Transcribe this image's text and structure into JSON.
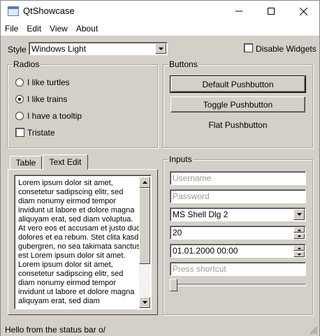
{
  "window": {
    "title": "QtShowcase"
  },
  "menu": {
    "items": [
      "File",
      "Edit",
      "View",
      "About"
    ]
  },
  "style": {
    "label": "Style",
    "value": "Windows Light"
  },
  "disable_widgets": {
    "label": "Disable Widgets",
    "checked": false
  },
  "radios": {
    "title": "Radios",
    "items": [
      {
        "label": "I like turtles",
        "checked": false
      },
      {
        "label": "I like trains",
        "checked": true
      },
      {
        "label": "I have a tooltip",
        "checked": false
      }
    ],
    "tristate": {
      "label": "Tristate",
      "checked": false
    }
  },
  "buttons": {
    "title": "Buttons",
    "default_label": "Default Pushbutton",
    "toggle_label": "Toggle Pushbutton",
    "flat_label": "Flat Pushbutton"
  },
  "tabs": {
    "items": [
      "Table",
      "Text Edit"
    ],
    "active": "Text Edit",
    "text": "Lorem ipsum dolor sit amet, consetetur sadipscing elitr, sed diam nonumy eirmod tempor invidunt ut labore et dolore magna aliquyam erat, sed diam voluptua. At vero eos et accusam et justo duo dolores et ea rebum. Stet clita kasd gubergren, no sea takimata sanctus est Lorem ipsum dolor sit amet. Lorem ipsum dolor sit amet, consetetur sadipscing elitr, sed diam nonumy eirmod tempor invidunt ut labore et dolore magna aliquyam erat, sed diam"
  },
  "inputs": {
    "title": "Inputs",
    "username_placeholder": "Username",
    "password_placeholder": "Password",
    "font_value": "MS Shell Dlg 2",
    "spin_value": "20",
    "datetime_value": "01.01.2000 00:00",
    "shortcut_placeholder": "Press shortcut",
    "slider_value": 0
  },
  "status": {
    "text": "Hello from the status bar o/"
  }
}
